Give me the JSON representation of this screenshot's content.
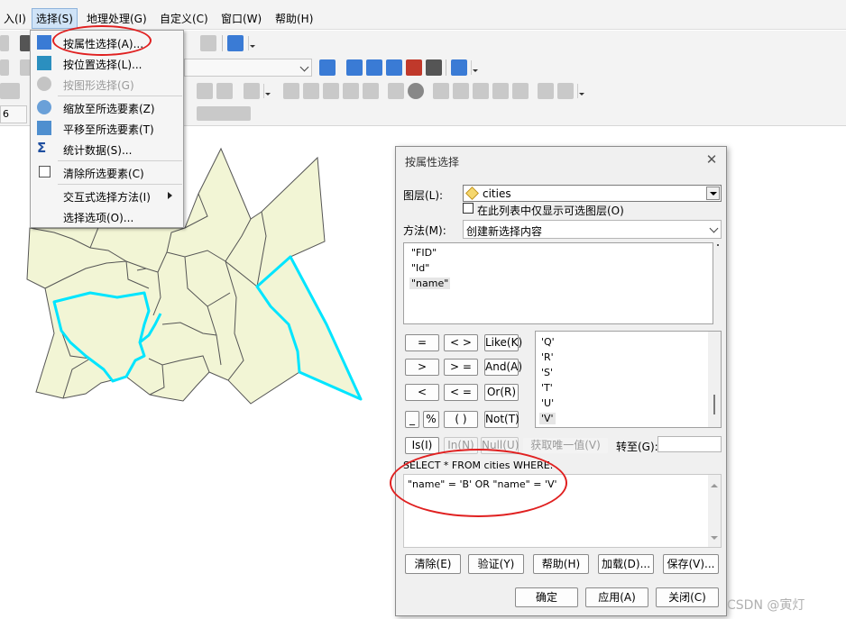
{
  "menubar": {
    "items": [
      {
        "label": "入(I)"
      },
      {
        "label": "选择(S)"
      },
      {
        "label": "地理处理(G)"
      },
      {
        "label": "自定义(C)"
      },
      {
        "label": "窗口(W)"
      },
      {
        "label": "帮助(H)"
      }
    ]
  },
  "select_menu": {
    "items": [
      {
        "label": "按属性选择(A)...",
        "icon": "table-select-icon"
      },
      {
        "label": "按位置选择(L)...",
        "icon": "location-select-icon"
      },
      {
        "label": "按图形选择(G)",
        "icon": "graphic-select-icon",
        "disabled": true
      },
      {
        "label": "缩放至所选要素(Z)",
        "icon": "zoom-selected-icon"
      },
      {
        "label": "平移至所选要素(T)",
        "icon": "pan-selected-icon"
      },
      {
        "label": "统计数据(S)...",
        "icon": "sigma-icon"
      },
      {
        "label": "清除所选要素(C)",
        "icon": "clear-selection-icon"
      },
      {
        "label": "交互式选择方法(I)",
        "icon": "",
        "submenu": true
      },
      {
        "label": "选择选项(O)...",
        "icon": ""
      }
    ]
  },
  "toolbar": {
    "scale_value": "6"
  },
  "dialog": {
    "title": "按属性选择",
    "layer_label": "图层(L):",
    "layer_value": "cities",
    "only_selectable_label": "在此列表中仅显示可选图层(O)",
    "method_label": "方法(M):",
    "method_value": "创建新选择内容",
    "fields": [
      "\"FID\"",
      "\"Id\"",
      "\"name\""
    ],
    "operators": {
      "eq": "=",
      "ne": "< >",
      "like": "Like(K)",
      "gt": ">",
      "ge": "> =",
      "and": "And(A)",
      "lt": "<",
      "le": "< =",
      "or": "Or(R)",
      "underscore": "_",
      "percent": "%",
      "paren": "( )",
      "not": "Not(T)"
    },
    "values": [
      "'Q'",
      "'R'",
      "'S'",
      "'T'",
      "'U'",
      "'V'"
    ],
    "is_label": "Is(I)",
    "in_label": "In(N)",
    "null_label": "Null(U)",
    "get_unique_label": "获取唯一值(V)",
    "goto_label": "转至(G):",
    "goto_value": "",
    "sql_prefix": "SELECT * FROM cities WHERE:",
    "sql_expression": "\"name\" = 'B' OR \"name\" = 'V'",
    "buttons": {
      "clear": "清除(E)",
      "verify": "验证(Y)",
      "help": "帮助(H)",
      "load": "加载(D)...",
      "save": "保存(V)...",
      "ok": "确定",
      "apply": "应用(A)",
      "close": "关闭(C)"
    }
  },
  "colors": {
    "polygon_fill": "#f2f5d5",
    "polygon_stroke": "#555555",
    "selection": "#00e5ff",
    "annotation": "#e02020"
  },
  "watermark": "CSDN @寅灯"
}
